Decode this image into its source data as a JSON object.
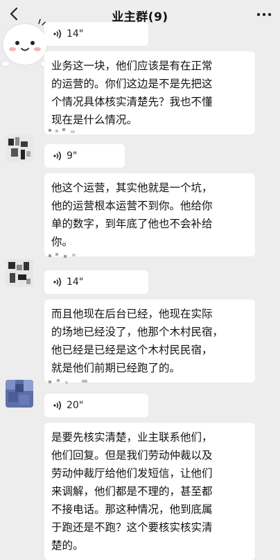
{
  "header": {
    "title": "业主群(9)"
  },
  "messages": [
    {
      "voice_duration": "14\"",
      "text": "业务这一块，他们应该是有在正常\n的运营的。你们这边是不是先把这\n个情况具体核实清楚先？我也不懂\n现在是什么情况。"
    },
    {
      "voice_duration": "9\"",
      "text": "他这个运营，其实他就是一个坑，\n他的运营根本运营不到你。他给你\n单的数字，到年底了他也不会补给\n你。"
    },
    {
      "voice_duration": "14\"",
      "text": "而且他现在后台已经，他现在实际\n的场地已经没了，他那个木村民宿，\n他已经是已经是这个木村民民宿，\n就是他们前期已经跑了的。"
    },
    {
      "voice_duration": "20\"",
      "text": "是要先核实清楚，业主联系他们，\n他们回复。但是我们劳动仲裁以及\n劳动仲裁厅给他们发短信，让他们\n来调解，他们都是不理的，甚至都\n不接电话。那这种情况，他到底属\n于跑还是不跑？这个要核实核实清\n楚的。"
    }
  ],
  "colors": {
    "background": "#ededed",
    "bubble": "#ffffff",
    "text": "#111111"
  },
  "icons": [
    "back-arrow-icon",
    "more-icon",
    "voice-wave-icon"
  ]
}
